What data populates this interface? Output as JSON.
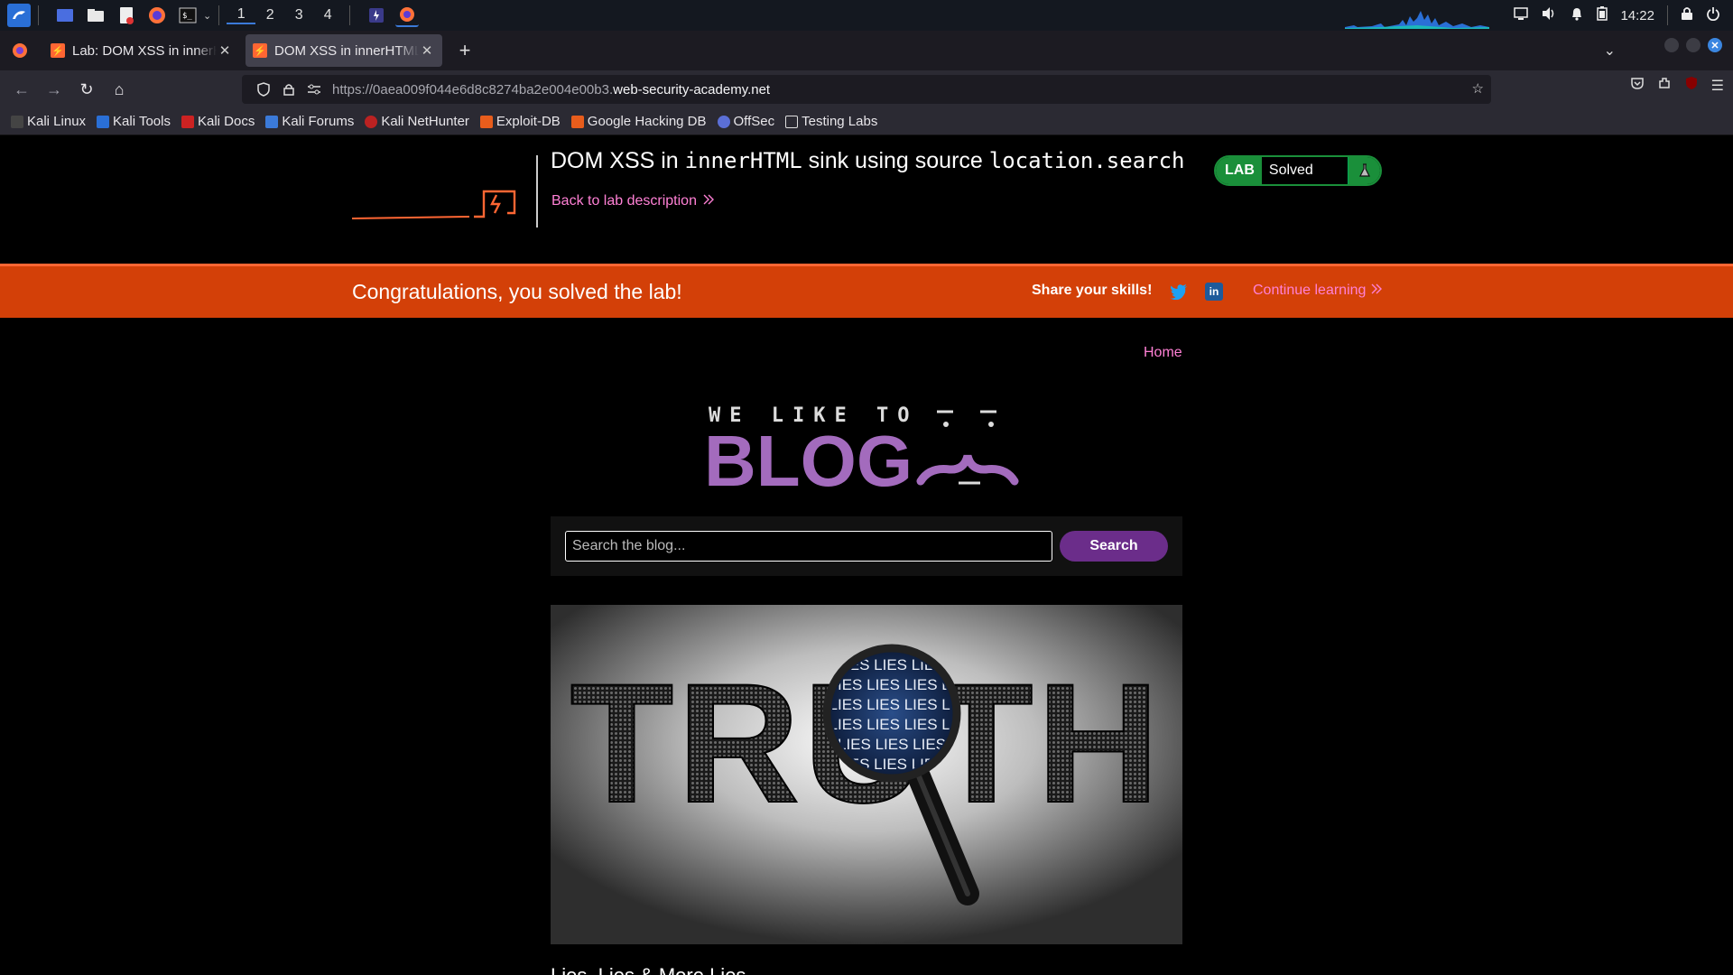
{
  "taskbar": {
    "workspaces": [
      "1",
      "2",
      "3",
      "4"
    ],
    "clock": "14:22"
  },
  "browser": {
    "tabs": [
      {
        "title": "Lab: DOM XSS in innerHTML sink",
        "active": false
      },
      {
        "title": "DOM XSS in innerHTML sink",
        "active": true
      }
    ],
    "url_dim": "https://0aea009f044e6d8c8274ba2e004e00b3.",
    "url_domain": "web-security-academy.net",
    "bookmarks": [
      "Kali Linux",
      "Kali Tools",
      "Kali Docs",
      "Kali Forums",
      "Kali NetHunter",
      "Exploit-DB",
      "Google Hacking DB",
      "OffSec",
      "Testing Labs"
    ]
  },
  "lab": {
    "title_prefix": "DOM XSS in ",
    "title_code1": "innerHTML",
    "title_middle": " sink using source ",
    "title_code2": "location.search",
    "back_link": "Back to lab description",
    "status_tag": "LAB",
    "status_value": "Solved"
  },
  "banner": {
    "message": "Congratulations, you solved the lab!",
    "share": "Share your skills!",
    "continue": "Continue learning"
  },
  "blog": {
    "nav_home": "Home",
    "logo_top": "WE LIKE TO",
    "logo_main": "BLOG",
    "search_placeholder": "Search the blog...",
    "search_button": "Search",
    "image_word": "TRUTH",
    "image_lens_text": [
      "ES LIES LIE",
      "LIES LIES LIES LI",
      "LIES LIES LIES LI",
      "LIES LIES LIES LI",
      "LIES LIES LIES",
      "ES LIES LIE"
    ],
    "post_title": "Lies, Lies & More Lies"
  },
  "colors": {
    "banner": "#d34008",
    "link": "#ff80d5",
    "lab_green": "#1a8f3a",
    "search_button": "#6b2d8a",
    "blog_purple": "#a36bbd"
  }
}
